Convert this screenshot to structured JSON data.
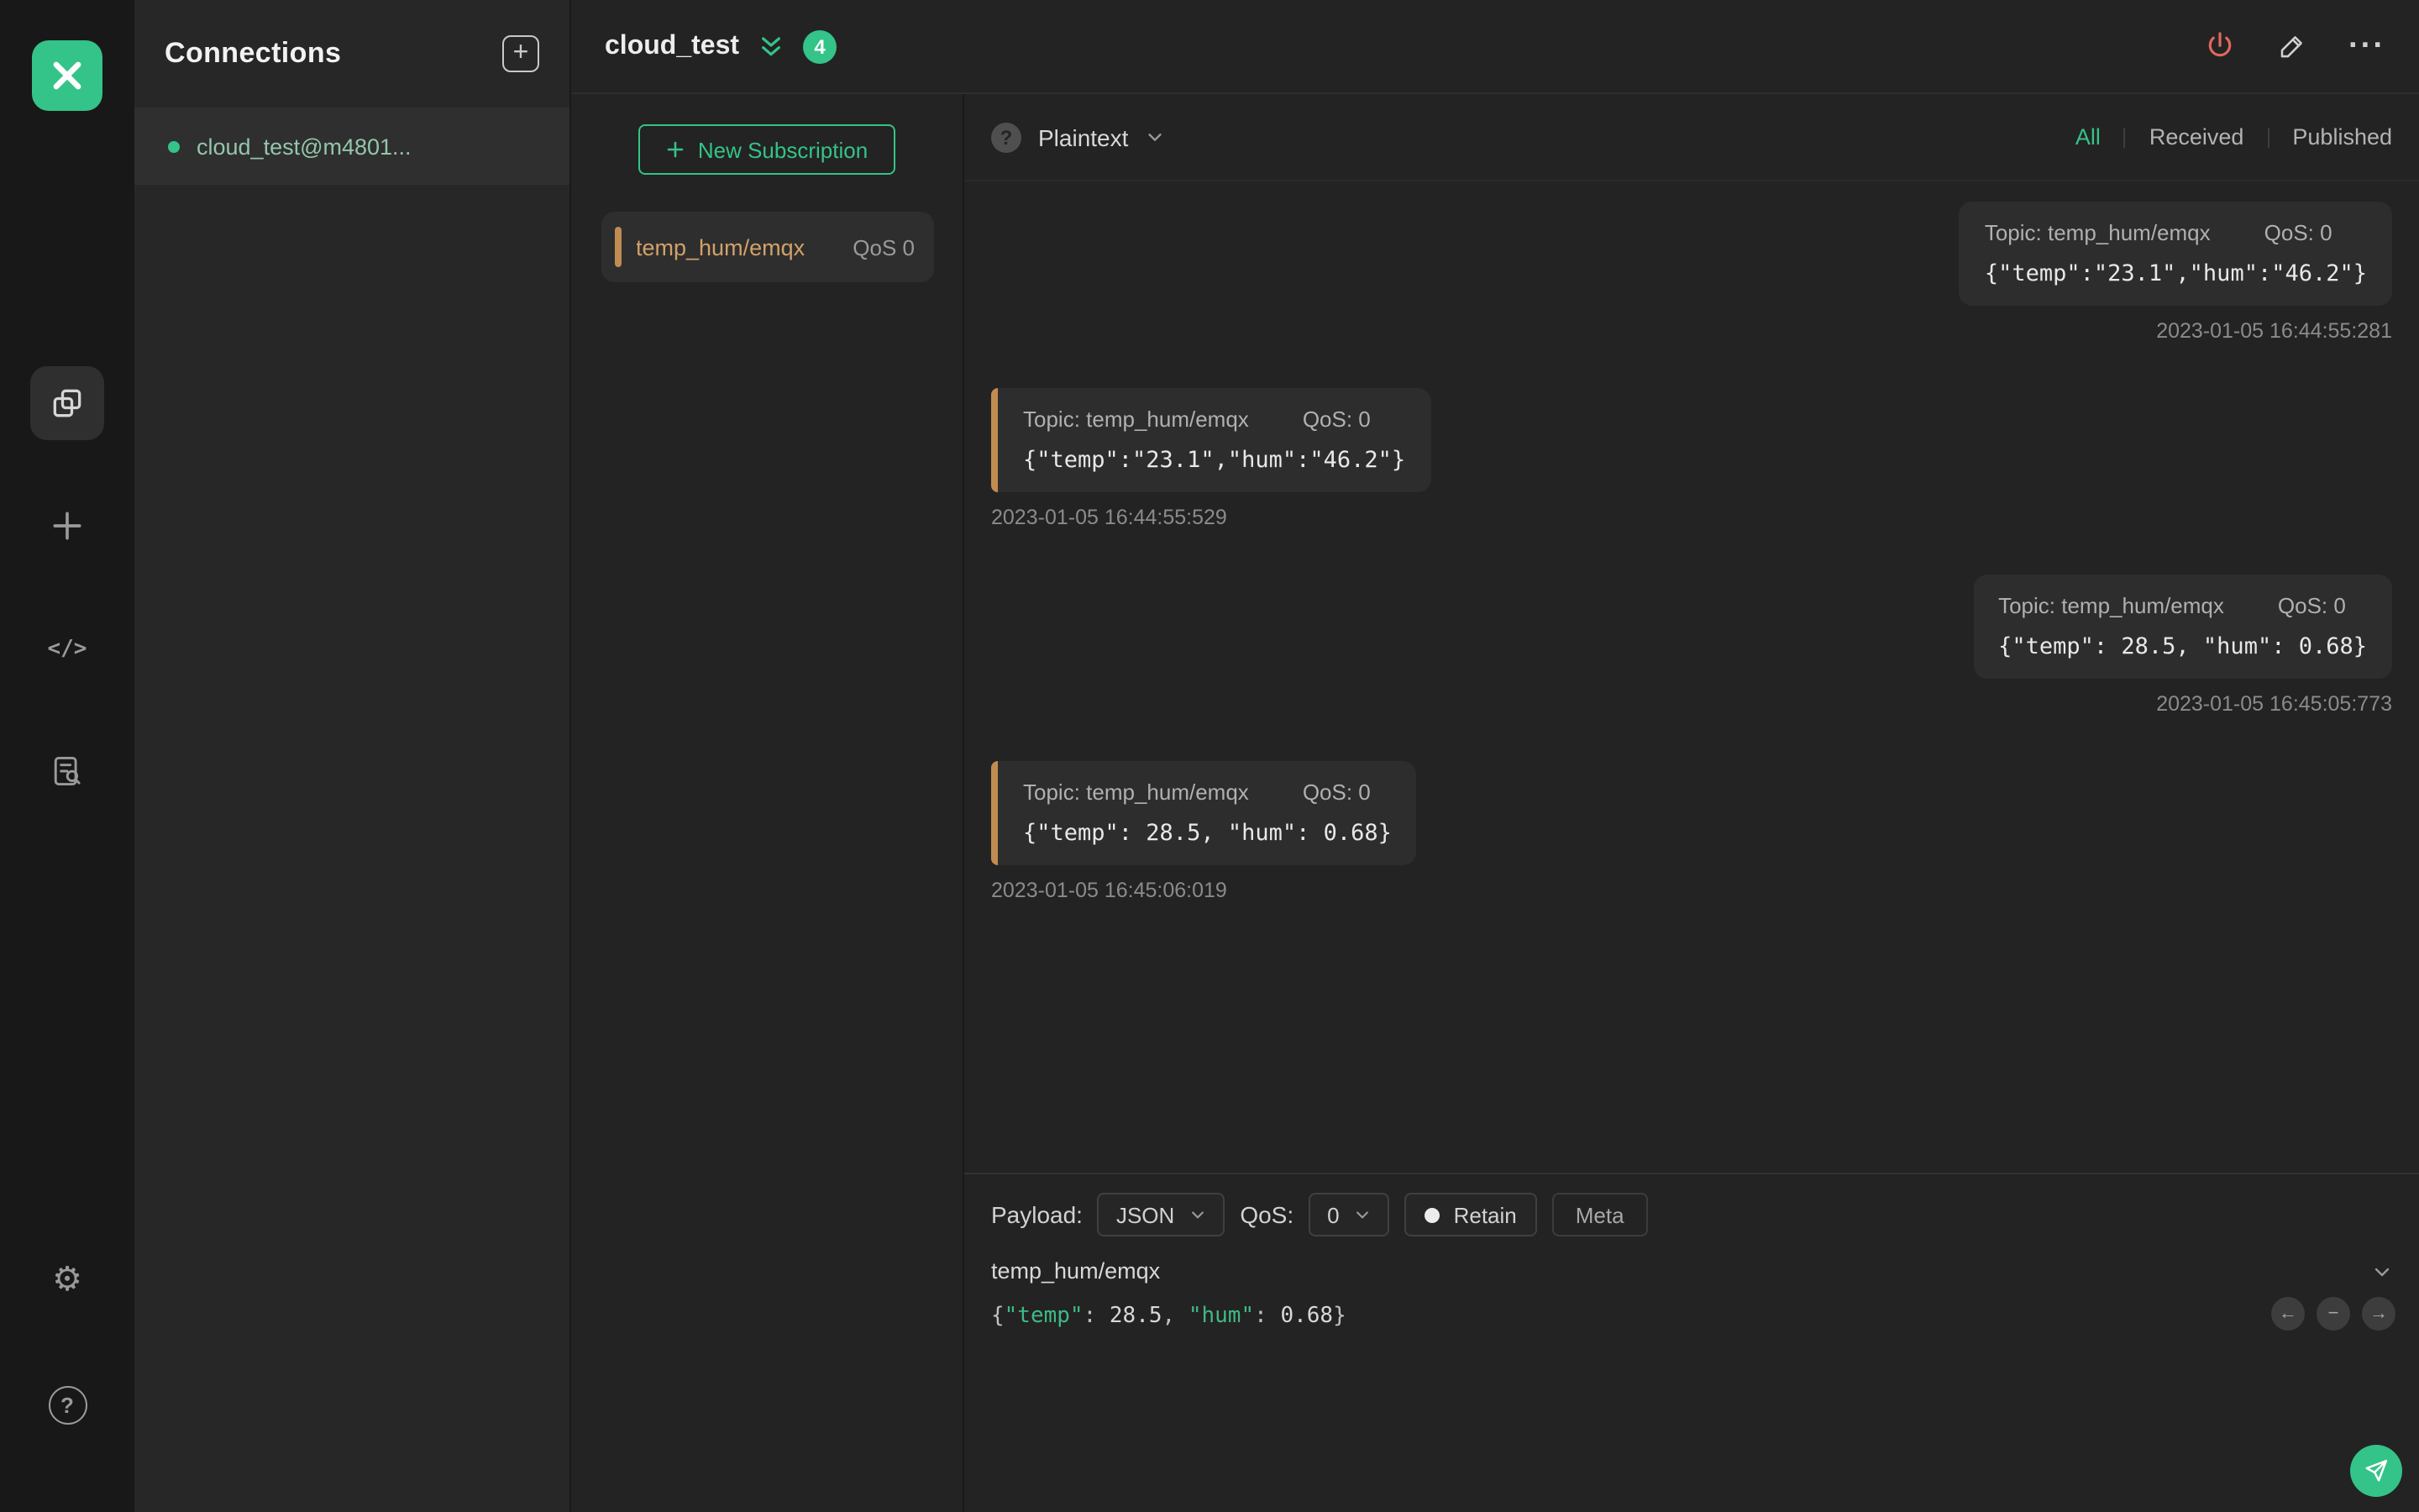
{
  "colors": {
    "green": "#34c388",
    "orange": "#d2a269",
    "orange_bar": "#c08c51",
    "red": "#e0695c"
  },
  "icons": {
    "gear": "⚙",
    "help_mark": "?",
    "more": "···",
    "code": "</>",
    "plus_box": "+",
    "history_prev": "←",
    "history_pause": "−",
    "history_next": "→"
  },
  "connections": {
    "title": "Connections",
    "items": [
      {
        "name": "cloud_test@m4801...",
        "status": "connected"
      }
    ]
  },
  "header": {
    "title": "cloud_test",
    "badge": "4"
  },
  "subscriptions": {
    "new_button": "New Subscription",
    "items": [
      {
        "topic": "temp_hum/emqx",
        "qos": "QoS 0"
      }
    ]
  },
  "toolbar": {
    "format": "Plaintext",
    "filters": [
      "All",
      "Received",
      "Published"
    ],
    "active_filter": "All"
  },
  "messages": [
    {
      "direction": "published",
      "topic": "Topic: temp_hum/emqx",
      "qos": "QoS: 0",
      "payload": "{\"temp\":\"23.1\",\"hum\":\"46.2\"}",
      "time": "2023-01-05 16:44:55:281"
    },
    {
      "direction": "received",
      "topic": "Topic: temp_hum/emqx",
      "qos": "QoS: 0",
      "payload": "{\"temp\":\"23.1\",\"hum\":\"46.2\"}",
      "time": "2023-01-05 16:44:55:529"
    },
    {
      "direction": "published",
      "topic": "Topic: temp_hum/emqx",
      "qos": "QoS: 0",
      "payload": "{\"temp\": 28.5, \"hum\": 0.68}",
      "time": "2023-01-05 16:45:05:773"
    },
    {
      "direction": "received",
      "topic": "Topic: temp_hum/emqx",
      "qos": "QoS: 0",
      "payload": "{\"temp\": 28.5, \"hum\": 0.68}",
      "time": "2023-01-05 16:45:06:019"
    }
  ],
  "publish": {
    "payload_label": "Payload:",
    "format": "JSON",
    "qos_label": "QoS:",
    "qos": "0",
    "retain": "Retain",
    "meta": "Meta",
    "topic": "temp_hum/emqx",
    "editor_tokens": {
      "t0": "{",
      "t1": "\"temp\"",
      "t2": ": ",
      "t3": "28.5",
      "t4": ", ",
      "t5": "\"hum\"",
      "t6": ": ",
      "t7": "0.68",
      "t8": "}"
    }
  }
}
